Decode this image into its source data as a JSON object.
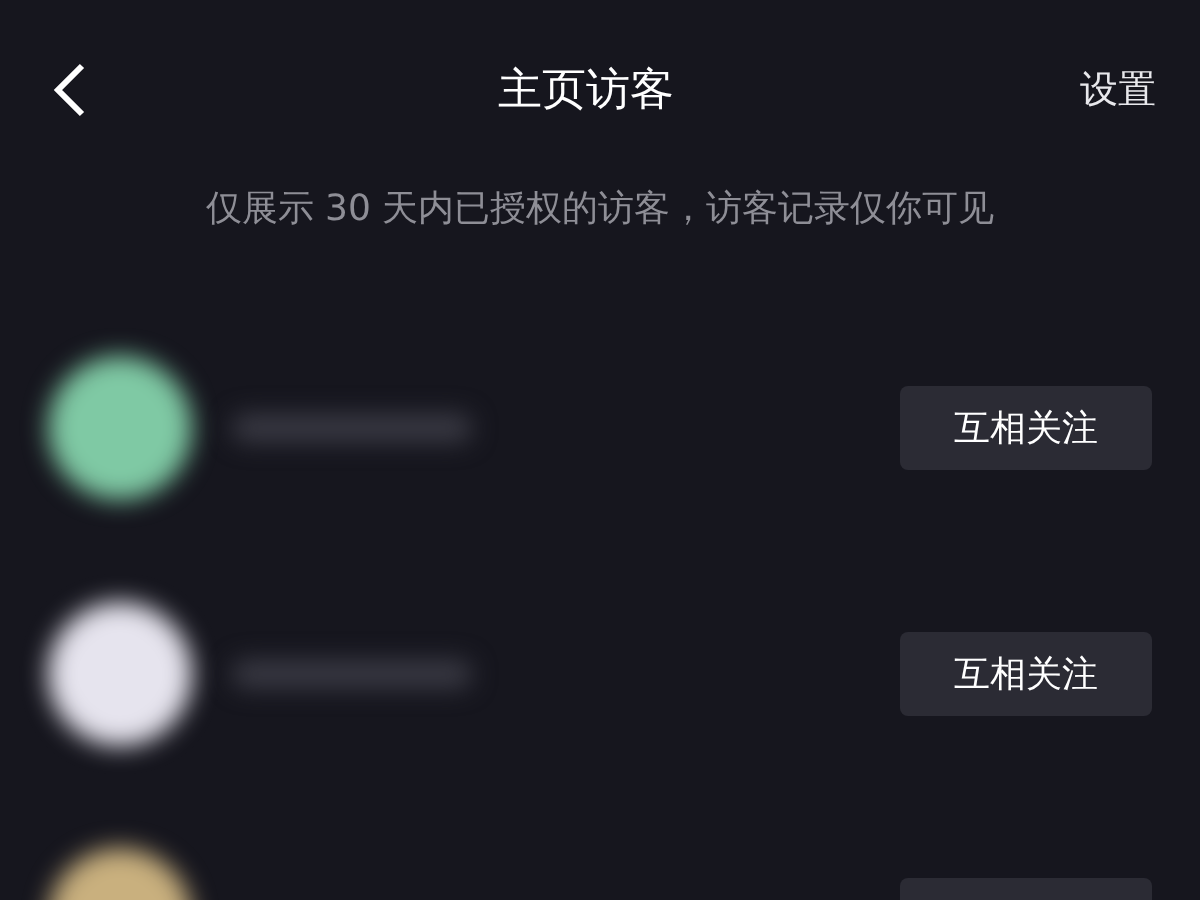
{
  "header": {
    "title": "主页访客",
    "action": "设置"
  },
  "notice": "仅展示 30 天内已授权的访客，访客记录仅你可见",
  "visitors": [
    {
      "color": "#7fc9a4",
      "button": "互相关注"
    },
    {
      "color": "#e6e4ee",
      "button": "互相关注"
    },
    {
      "color": "#c9b07e"
    }
  ]
}
